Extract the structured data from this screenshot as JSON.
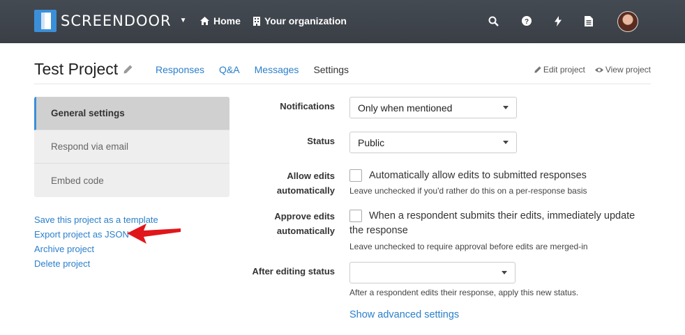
{
  "brand": {
    "name": "SCREENDOOR",
    "color": "#3b8fd9"
  },
  "nav": {
    "home": "Home",
    "organization": "Your organization",
    "icons": [
      "search-icon",
      "help-icon",
      "bolt-icon",
      "document-icon"
    ]
  },
  "project": {
    "title": "Test Project",
    "tabs": [
      "Responses",
      "Q&A",
      "Messages",
      "Settings"
    ],
    "active_tab": "Settings",
    "edit_project": "Edit project",
    "view_project": "View project"
  },
  "sidebar": {
    "items": [
      "General settings",
      "Respond via email",
      "Embed code"
    ],
    "active": "General settings",
    "links": [
      "Save this project as a template",
      "Export project as JSON",
      "Archive project",
      "Delete project"
    ]
  },
  "form": {
    "notifications": {
      "label": "Notifications",
      "value": "Only when mentioned"
    },
    "status": {
      "label": "Status",
      "value": "Public"
    },
    "allow_edits": {
      "label_line1": "Allow edits",
      "label_line2": "automatically",
      "text": "Automatically allow edits to submitted responses",
      "help": "Leave unchecked if you'd rather do this on a per-response basis",
      "checked": false
    },
    "approve_edits": {
      "label_line1": "Approve edits",
      "label_line2": "automatically",
      "text_line1": "When a respondent submits their edits, immediately update",
      "text_line2": "the response",
      "help": "Leave unchecked to require approval before edits are merged-in",
      "checked": false
    },
    "after_editing": {
      "label": "After editing status",
      "value": "",
      "help": "After a respondent edits their response, apply this new status."
    },
    "advanced_link": "Show advanced settings"
  },
  "annotation": {
    "arrow_color": "#e0161b"
  }
}
